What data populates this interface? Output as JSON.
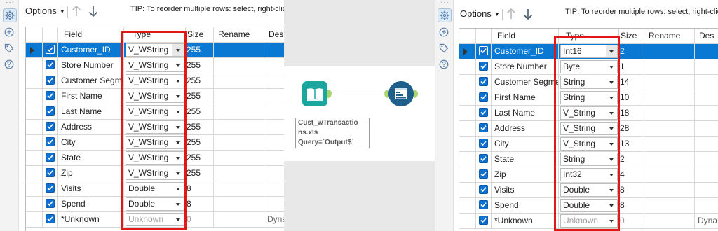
{
  "toolbar": {
    "options_label": "Options",
    "tip": "TIP: To reorder multiple rows: select, right-click"
  },
  "columns": {
    "field": "Field",
    "type": "Type",
    "size": "Size",
    "rename": "Rename",
    "description": "Des"
  },
  "left_grid": {
    "rows": [
      {
        "field": "Customer_ID",
        "type": "V_WString",
        "size": "255",
        "rename": "",
        "desc": ""
      },
      {
        "field": "Store Number",
        "type": "V_WString",
        "size": "255",
        "rename": "",
        "desc": ""
      },
      {
        "field": "Customer Segment",
        "type": "V_WString",
        "size": "255",
        "rename": "",
        "desc": ""
      },
      {
        "field": "First Name",
        "type": "V_WString",
        "size": "255",
        "rename": "",
        "desc": ""
      },
      {
        "field": "Last Name",
        "type": "V_WString",
        "size": "255",
        "rename": "",
        "desc": ""
      },
      {
        "field": "Address",
        "type": "V_WString",
        "size": "255",
        "rename": "",
        "desc": ""
      },
      {
        "field": "City",
        "type": "V_WString",
        "size": "255",
        "rename": "",
        "desc": ""
      },
      {
        "field": "State",
        "type": "V_WString",
        "size": "255",
        "rename": "",
        "desc": ""
      },
      {
        "field": "Zip",
        "type": "V_WString",
        "size": "255",
        "rename": "",
        "desc": ""
      },
      {
        "field": "Visits",
        "type": "Double",
        "size": "8",
        "rename": "",
        "desc": ""
      },
      {
        "field": "Spend",
        "type": "Double",
        "size": "8",
        "rename": "",
        "desc": ""
      },
      {
        "field": "*Unknown",
        "type": "Unknown",
        "size": "0",
        "rename": "",
        "desc": "Dyna"
      }
    ]
  },
  "right_grid": {
    "rows": [
      {
        "field": "Customer_ID",
        "type": "Int16",
        "size": "2",
        "rename": "",
        "desc": ""
      },
      {
        "field": "Store Number",
        "type": "Byte",
        "size": "1",
        "rename": "",
        "desc": ""
      },
      {
        "field": "Customer Segment",
        "type": "String",
        "size": "14",
        "rename": "",
        "desc": ""
      },
      {
        "field": "First Name",
        "type": "String",
        "size": "10",
        "rename": "",
        "desc": ""
      },
      {
        "field": "Last Name",
        "type": "V_String",
        "size": "18",
        "rename": "",
        "desc": ""
      },
      {
        "field": "Address",
        "type": "V_String",
        "size": "28",
        "rename": "",
        "desc": ""
      },
      {
        "field": "City",
        "type": "V_String",
        "size": "13",
        "rename": "",
        "desc": ""
      },
      {
        "field": "State",
        "type": "String",
        "size": "2",
        "rename": "",
        "desc": ""
      },
      {
        "field": "Zip",
        "type": "Int32",
        "size": "4",
        "rename": "",
        "desc": ""
      },
      {
        "field": "Visits",
        "type": "Double",
        "size": "8",
        "rename": "",
        "desc": ""
      },
      {
        "field": "Spend",
        "type": "Double",
        "size": "8",
        "rename": "",
        "desc": ""
      },
      {
        "field": "*Unknown",
        "type": "Unknown",
        "size": "0",
        "rename": "",
        "desc": "Dyna"
      }
    ]
  },
  "canvas": {
    "annotation_line1": "Cust_wTransactio",
    "annotation_line2": "ns.xls",
    "annotation_line3": "Query=`Output$`",
    "input_tool_color": "#1aa7a0",
    "output_tool_color": "#1f5f8b",
    "connector_color": "#a6d56a"
  },
  "colors": {
    "selection": "#0a79d4",
    "highlight_box": "#e01818",
    "checkbox": "#1070d0"
  },
  "icons": [
    "gear-icon",
    "anchor-icon",
    "tag-icon",
    "help-icon",
    "arrow-up-icon",
    "arrow-down-icon",
    "book-icon",
    "browse-icon"
  ]
}
